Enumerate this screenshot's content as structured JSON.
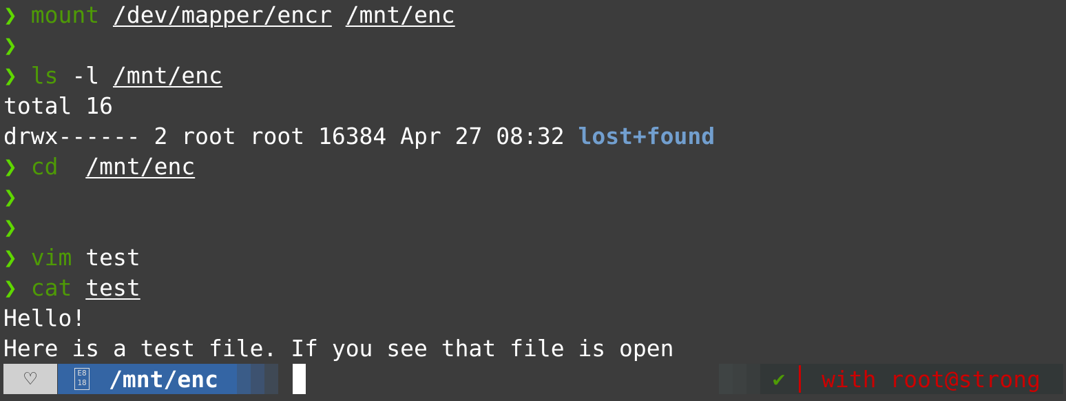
{
  "terminal": {
    "prompt_symbol": "❯",
    "lines": [
      {
        "type": "command",
        "cmd": "mount",
        "args": [
          {
            "text": "/dev/mapper/encr",
            "path": true
          },
          {
            "text": "/mnt/enc",
            "path": true
          }
        ]
      },
      {
        "type": "prompt_only"
      },
      {
        "type": "command",
        "cmd": "ls",
        "args": [
          {
            "text": "-l",
            "path": false
          },
          {
            "text": "/mnt/enc",
            "path": true
          }
        ]
      },
      {
        "type": "output",
        "text": "total 16"
      },
      {
        "type": "ls_entry",
        "text": "drwx------ 2 root root 16384 Apr 27 08:32 ",
        "name": "lost+found"
      },
      {
        "type": "command",
        "cmd": "cd",
        "args": [
          {
            "text": " /mnt/enc",
            "path": true
          }
        ]
      },
      {
        "type": "prompt_only"
      },
      {
        "type": "prompt_only"
      },
      {
        "type": "command",
        "cmd": "vim",
        "args": [
          {
            "text": "test",
            "path": false
          }
        ]
      },
      {
        "type": "command",
        "cmd": "cat",
        "args": [
          {
            "text": "test",
            "path": true
          }
        ]
      },
      {
        "type": "output",
        "text": "Hello!"
      },
      {
        "type": "output",
        "text": "Here is a test file. If you see that file is open"
      }
    ]
  },
  "statusbar": {
    "os_icon": "heart-outline-icon",
    "os_glyph": "♡",
    "lock_icon": "lock-icon",
    "lock_glyph": "E8\n18",
    "cwd": "/mnt/enc",
    "status_icon": "check-icon",
    "status_glyph": "✔",
    "context": "with root@strong"
  },
  "colors": {
    "background": "#3c3c3c",
    "prompt": "#5fd700",
    "command": "#4e9a06",
    "directory": "#729fcf",
    "dir_segment": "#3465a4",
    "os_segment": "#d0d0d0",
    "context_text": "#cc0000"
  }
}
